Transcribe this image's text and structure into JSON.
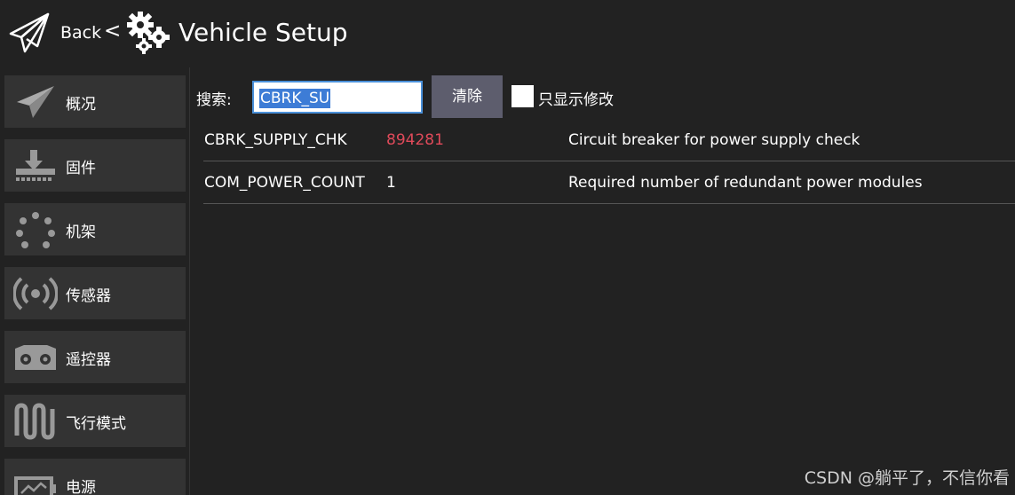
{
  "header": {
    "back_label": "Back",
    "separator": "<",
    "title": "Vehicle Setup",
    "plane_icon": "paper-plane-icon",
    "gear_icon": "gears-icon"
  },
  "sidebar": {
    "items": [
      {
        "label": "概况",
        "icon": "paper-plane-icon"
      },
      {
        "label": "固件",
        "icon": "download-icon"
      },
      {
        "label": "机架",
        "icon": "airframe-dots-icon"
      },
      {
        "label": "传感器",
        "icon": "radio-waves-icon"
      },
      {
        "label": "遥控器",
        "icon": "radio-controller-icon"
      },
      {
        "label": "飞行模式",
        "icon": "wave-icon"
      },
      {
        "label": "电源",
        "icon": "battery-icon"
      }
    ]
  },
  "search": {
    "label": "搜索:",
    "value": "CBRK_SU",
    "clear_label": "清除",
    "only_modified_label": "只显示修改",
    "only_modified_checked": false
  },
  "params": {
    "rows": [
      {
        "name": "CBRK_SUPPLY_CHK",
        "value": "894281",
        "description": "Circuit breaker for power supply check",
        "modified": true
      },
      {
        "name": "COM_POWER_COUNT",
        "value": "1",
        "description": "Required number of redundant power modules",
        "modified": false
      }
    ]
  },
  "colors": {
    "background": "#222222",
    "sidebar_item": "#333333",
    "button": "#5d5d6d",
    "modified_value": "#e04a5a",
    "selection": "#3d7cd6"
  },
  "watermark": "CSDN @躺平了，不信你看"
}
